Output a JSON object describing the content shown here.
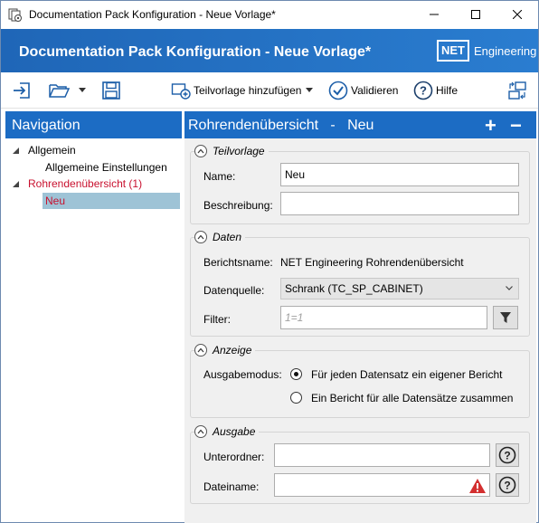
{
  "window": {
    "title": "Documentation Pack Konfiguration - Neue Vorlage*"
  },
  "banner": {
    "title": "Documentation Pack Konfiguration - Neue Vorlage*",
    "logo_net": "NET",
    "logo_engineering": "Engineering"
  },
  "toolbar": {
    "add_subtemplate_label": "Teilvorlage hinzufügen",
    "validate_label": "Validieren",
    "help_label": "Hilfe"
  },
  "nav": {
    "header": "Navigation",
    "items": [
      {
        "label": "Allgemein"
      },
      {
        "label": "Allgemeine Einstellungen"
      },
      {
        "label": "Rohrendenübersicht (1)"
      },
      {
        "label": "Neu"
      }
    ]
  },
  "main": {
    "header_title": "Rohrendenübersicht   -   Neu",
    "plus": "+",
    "minus": "−",
    "teilvorlage": {
      "legend": "Teilvorlage",
      "name_label": "Name:",
      "name_value": "Neu",
      "description_label": "Beschreibung:",
      "description_value": ""
    },
    "daten": {
      "legend": "Daten",
      "report_name_label": "Berichtsname:",
      "report_name_value": "NET Engineering Rohrendenübersicht",
      "datasource_label": "Datenquelle:",
      "datasource_value": "Schrank (TC_SP_CABINET)",
      "filter_label": "Filter:",
      "filter_placeholder": "1=1"
    },
    "anzeige": {
      "legend": "Anzeige",
      "output_mode_label": "Ausgabemodus:",
      "option_each": "Für jeden Datensatz ein eigener Bericht",
      "option_all": "Ein Bericht für alle Datensätze zusammen",
      "selected": "option_each"
    },
    "ausgabe": {
      "legend": "Ausgabe",
      "subfolder_label": "Unterordner:",
      "subfolder_value": "",
      "filename_label": "Dateiname:",
      "filename_value": ""
    }
  },
  "colors": {
    "accent": "#1c6cc4",
    "nav_selected": "#9ec3d6",
    "error_red": "#c8102e",
    "warning_red": "#d32f2f"
  }
}
